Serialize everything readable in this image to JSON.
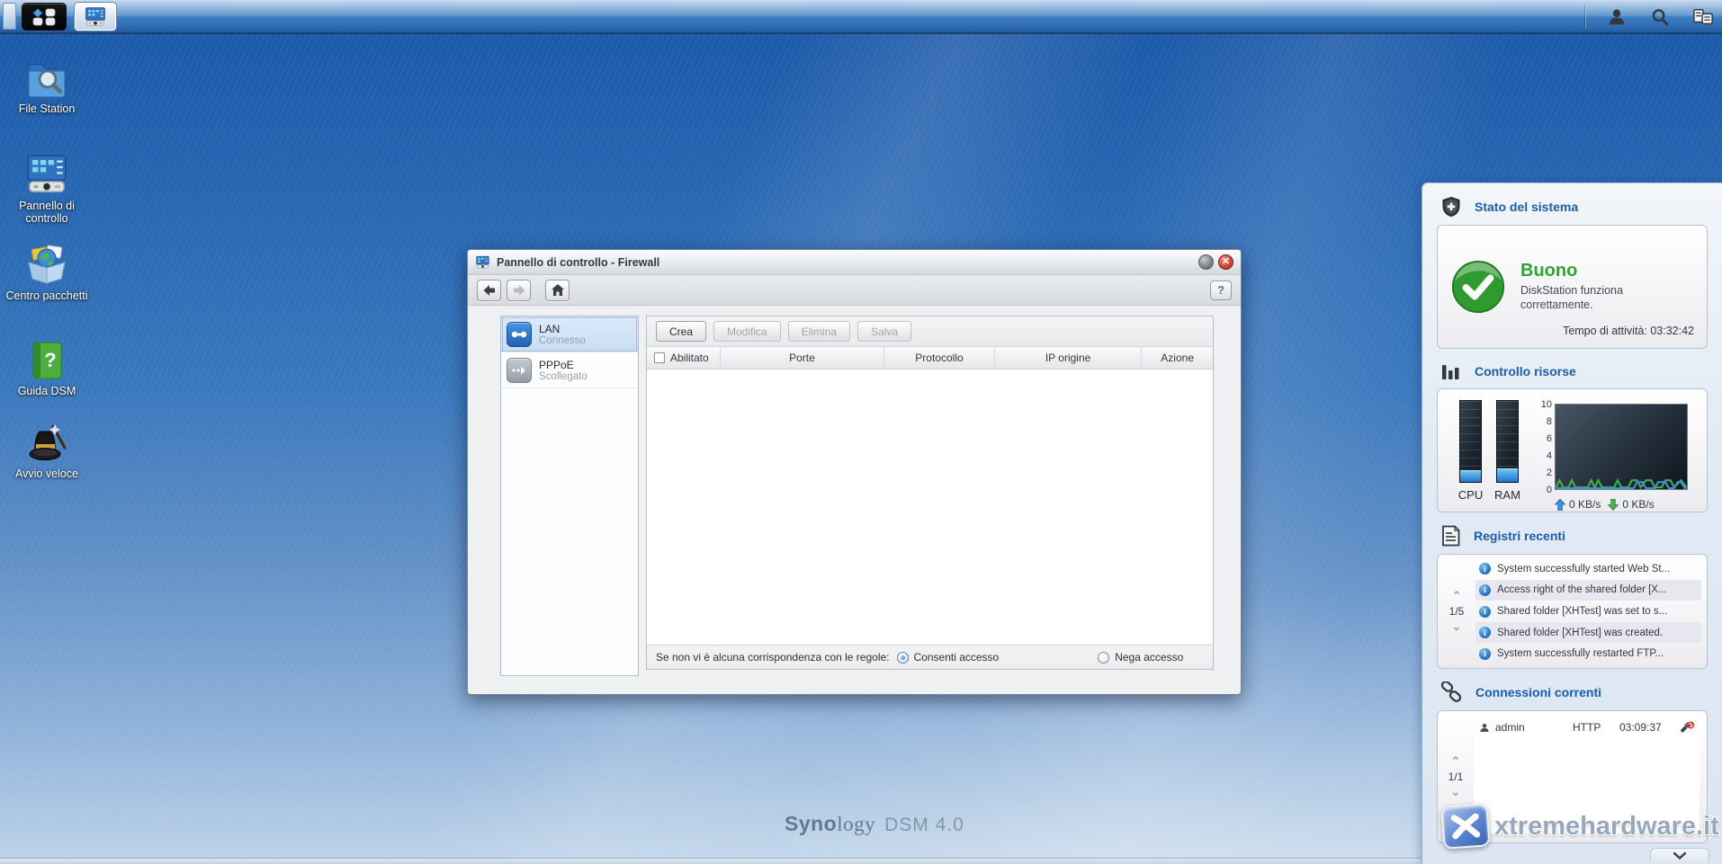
{
  "taskbar": {
    "main_menu": "main-menu",
    "task_item": "Pannello di controllo"
  },
  "desktop": {
    "icons": [
      {
        "label": "File Station"
      },
      {
        "label": "Pannello di controllo"
      },
      {
        "label": "Centro pacchetti"
      },
      {
        "label": "Guida DSM"
      },
      {
        "label": "Avvio veloce"
      }
    ],
    "watermark": {
      "brand_bold": "Syno",
      "brand_rest": "logy",
      "product": "DSM 4.0"
    }
  },
  "window": {
    "title": "Pannello di controllo - Firewall",
    "help_label": "?",
    "profiles": [
      {
        "name": "LAN",
        "status": "Connesso"
      },
      {
        "name": "PPPoE",
        "status": "Scollegato"
      }
    ],
    "buttons": [
      {
        "label": "Crea",
        "enabled": true
      },
      {
        "label": "Modifica",
        "enabled": false
      },
      {
        "label": "Elimina",
        "enabled": false
      },
      {
        "label": "Salva",
        "enabled": false
      }
    ],
    "table": {
      "headers": [
        "Abilitato",
        "Porte",
        "Protocollo",
        "IP origine",
        "Azione"
      ],
      "rows": []
    },
    "footer": {
      "label": "Se non vi è alcuna corrispondenza con le regole:",
      "options": [
        {
          "label": "Consenti accesso",
          "selected": true
        },
        {
          "label": "Nega accesso",
          "selected": false
        }
      ]
    }
  },
  "widget": {
    "system_status": {
      "title": "Stato del sistema",
      "status": "Buono",
      "description": "DiskStation funziona correttamente.",
      "uptime": "Tempo di attività: 03:32:42"
    },
    "resource_monitor": {
      "title": "Controllo risorse",
      "cpu_label": "CPU",
      "ram_label": "RAM",
      "axis": [
        "10",
        "8",
        "6",
        "4",
        "2",
        "0"
      ],
      "upload": "0 KB/s",
      "download": "0 KB/s"
    },
    "recent_logs": {
      "title": "Registri recenti",
      "page": "1/5",
      "entries": [
        {
          "text": "System successfully started Web St..."
        },
        {
          "text": "Access right of the shared folder [X..."
        },
        {
          "text": "Shared folder [XHTest] was set to s..."
        },
        {
          "text": "Shared folder [XHTest] was created."
        },
        {
          "text": "System successfully restarted FTP..."
        }
      ]
    },
    "connections": {
      "title": "Connessioni correnti",
      "page": "1/1",
      "rows": [
        {
          "user": "admin",
          "protocol": "HTTP",
          "time": "03:09:37"
        }
      ]
    },
    "watermark_text": "xtremehardware.it"
  }
}
